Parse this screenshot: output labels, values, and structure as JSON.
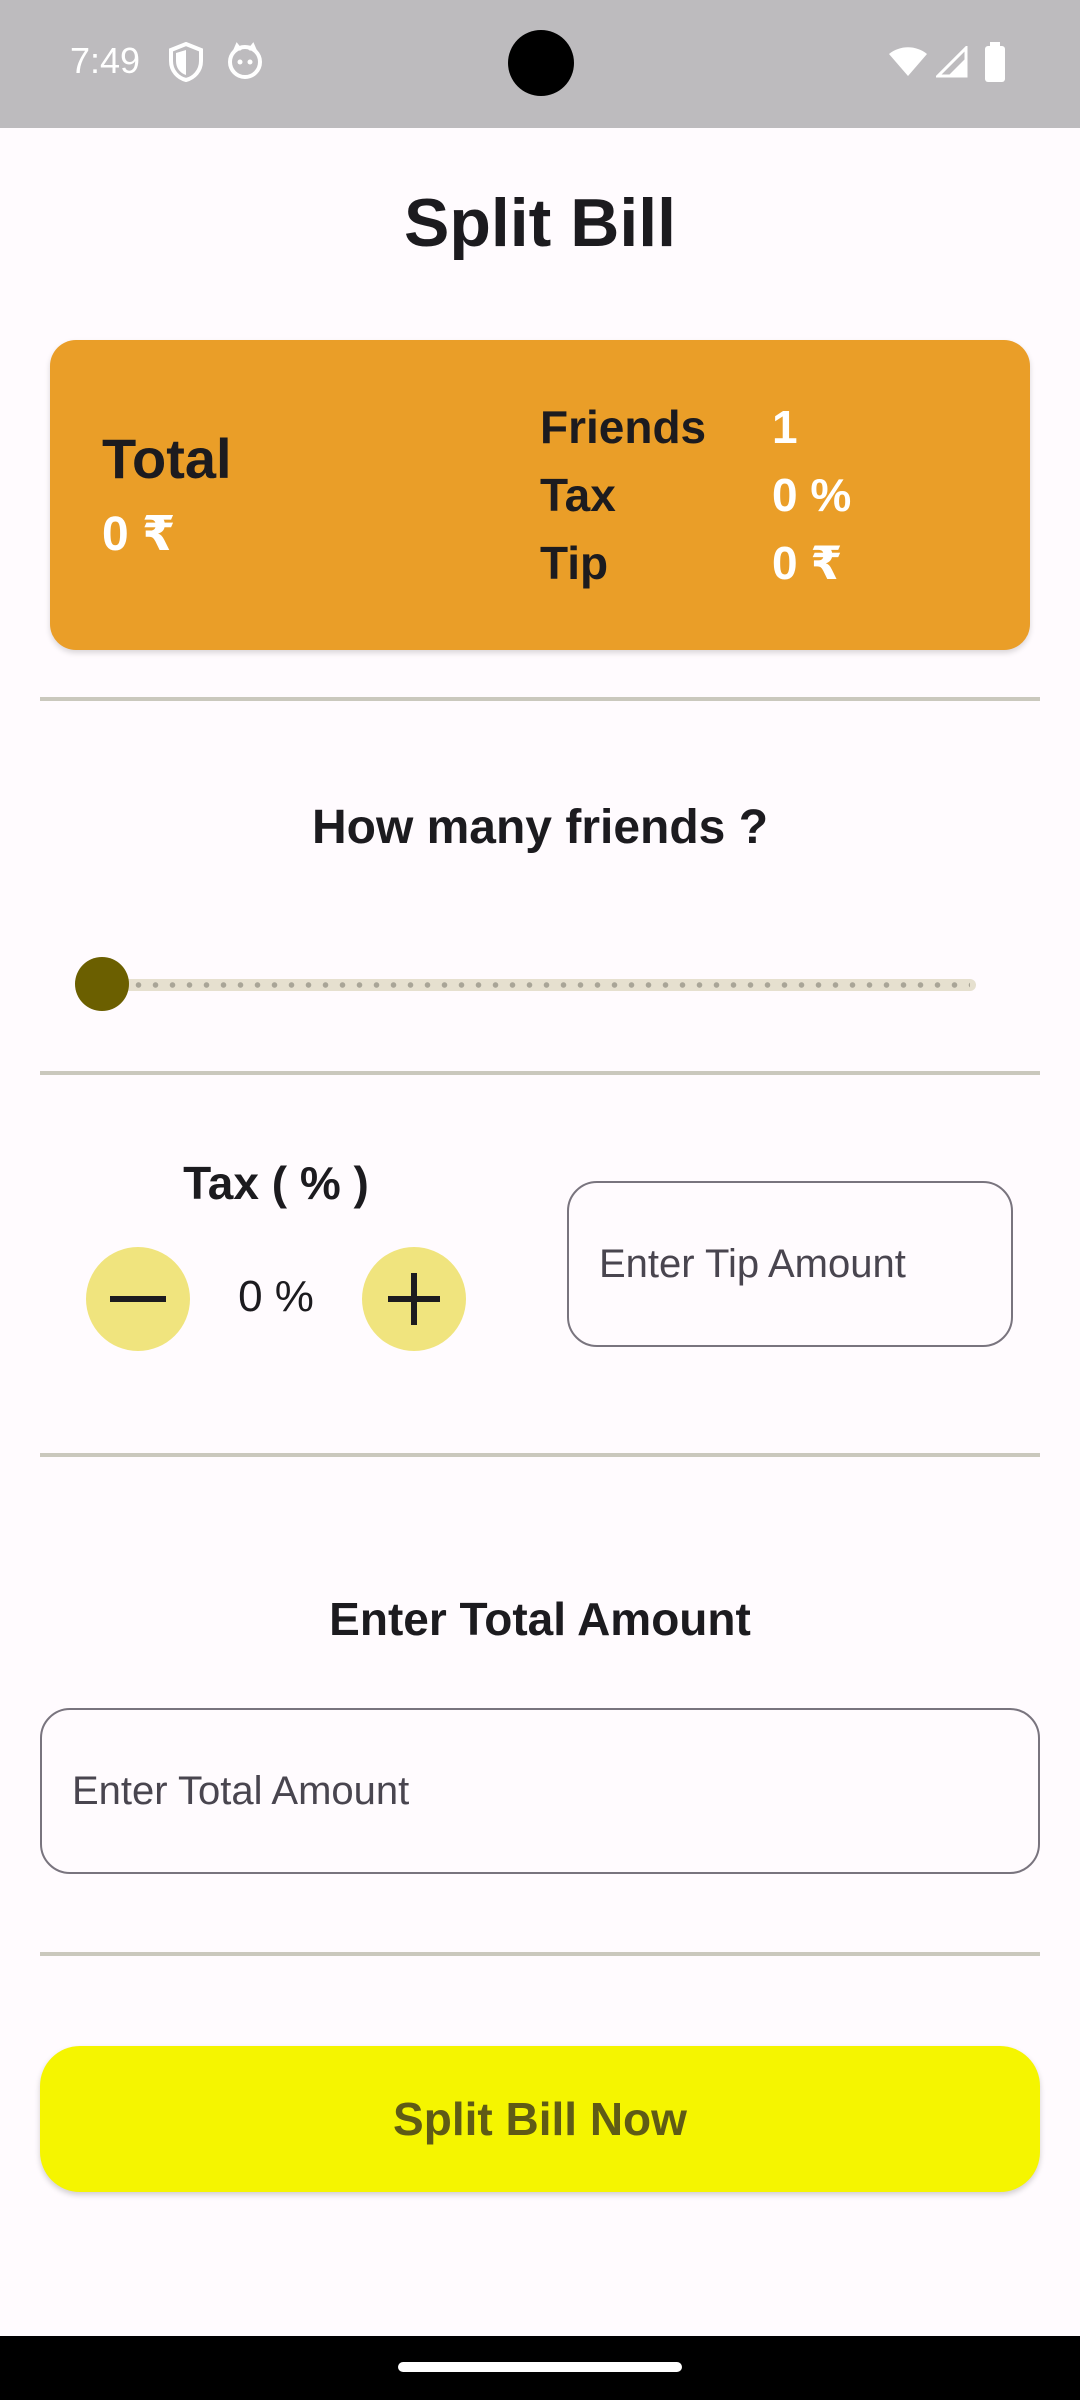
{
  "status_bar": {
    "time": "7:49",
    "icons": [
      "shield-icon",
      "cat-icon",
      "wifi-icon",
      "signal-icon",
      "battery-icon"
    ]
  },
  "title": "Split Bill",
  "summary": {
    "total_label": "Total",
    "total_value": "0 ₹",
    "friends_label": "Friends",
    "friends_value": "1",
    "tax_label": "Tax",
    "tax_value": "0 %",
    "tip_label": "Tip",
    "tip_value": "0 ₹"
  },
  "friends_section": {
    "heading": "How many friends ?",
    "slider_fraction": 0.0
  },
  "tax_section": {
    "label": "Tax ( % )",
    "value": "0 %",
    "decrement_icon": "minus-icon",
    "increment_icon": "plus-icon"
  },
  "tip_input": {
    "placeholder": "Enter Tip Amount",
    "value": ""
  },
  "total_section": {
    "heading": "Enter Total Amount",
    "placeholder": "Enter Total Amount",
    "value": ""
  },
  "split_button_label": "Split Bill Now",
  "colors": {
    "card": "#EA9E28",
    "primary_button": "#F5F500",
    "round_button": "#F0E47E",
    "slider_thumb": "#6B5F00"
  }
}
